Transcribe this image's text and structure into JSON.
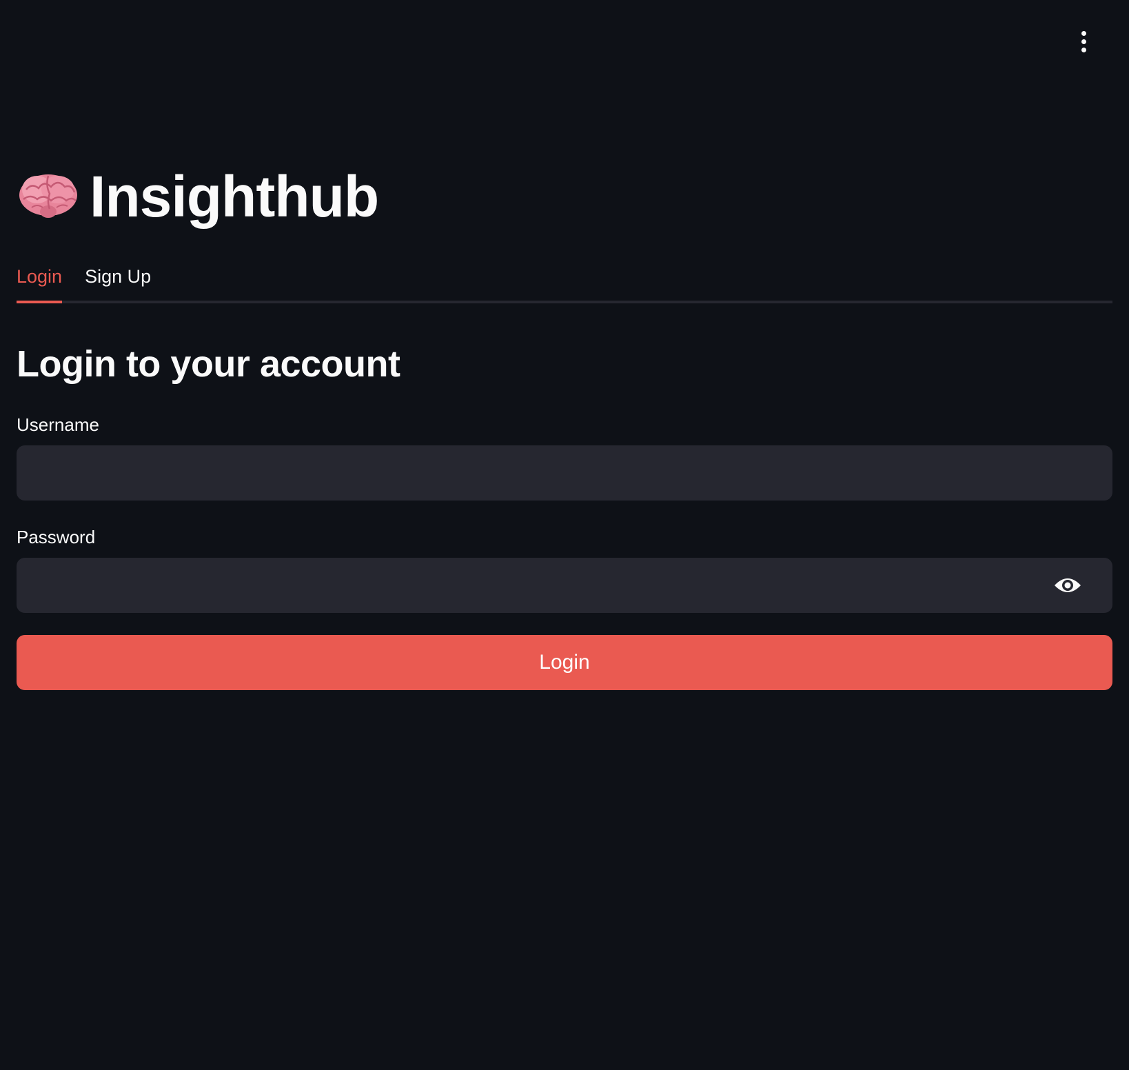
{
  "header": {
    "menu_icon": "vertical-ellipsis-icon"
  },
  "app": {
    "icon": "brain-emoji-icon",
    "title": "Insighthub"
  },
  "tabs": [
    {
      "label": "Login",
      "active": true
    },
    {
      "label": "Sign Up",
      "active": false
    }
  ],
  "form": {
    "heading": "Login to your account",
    "username": {
      "label": "Username",
      "value": "",
      "placeholder": ""
    },
    "password": {
      "label": "Password",
      "value": "",
      "placeholder": "",
      "toggle_icon": "eye-icon"
    },
    "submit_label": "Login"
  },
  "colors": {
    "background": "#0e1117",
    "input_background": "#262730",
    "accent": "#ea5a51",
    "text": "#fafafa"
  }
}
